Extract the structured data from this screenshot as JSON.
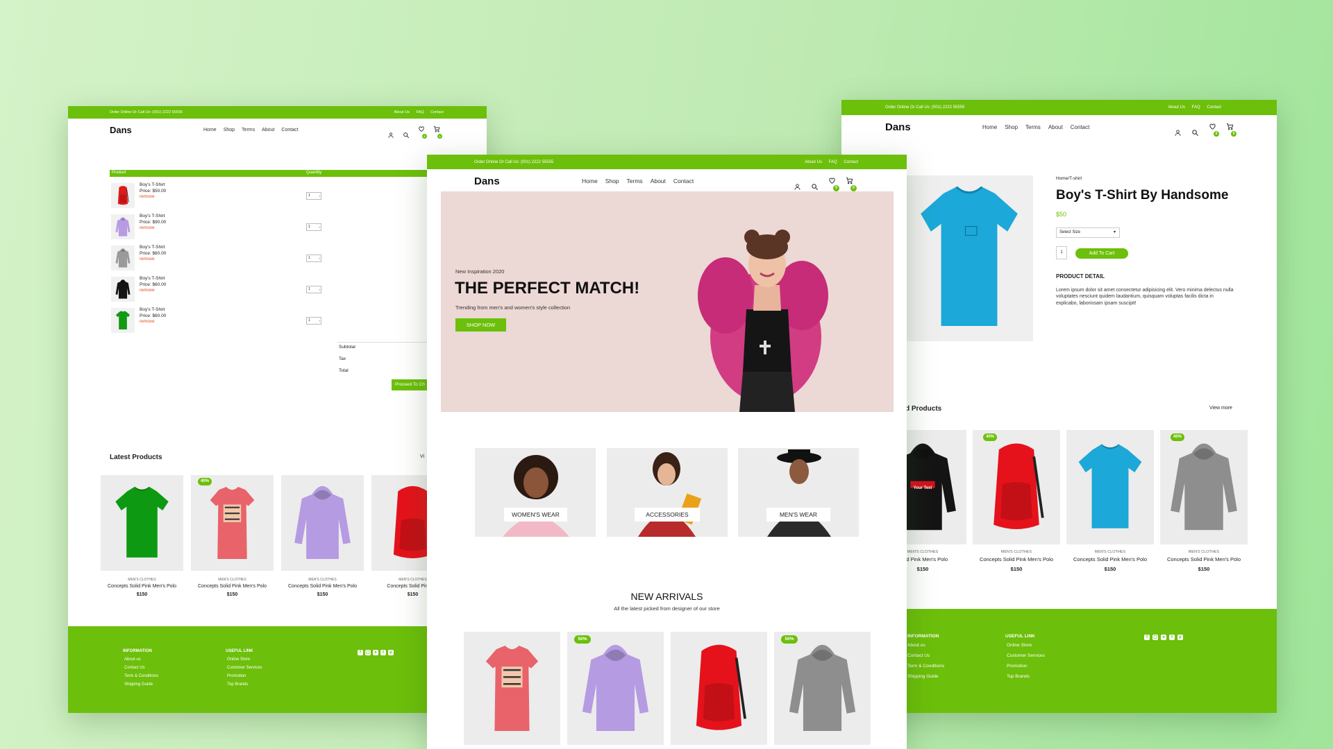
{
  "brand": {
    "name": "Dans",
    "accent": "#6cbf0a"
  },
  "topbar": {
    "phone": "Order Online Or Call Us: (001) 2222 55555",
    "links": [
      "About Us",
      "FAQ",
      "Contact"
    ]
  },
  "nav": [
    "Home",
    "Shop",
    "Terms",
    "About",
    "Contact"
  ],
  "icons": {
    "user": "user-icon",
    "search": "search-icon",
    "wishlist": "heart-icon",
    "cart": "cart-icon",
    "wishlist_count": "0",
    "cart_count": "0"
  },
  "cart_page": {
    "headers": {
      "product": "Product",
      "quantity": "Quantity"
    },
    "items": [
      {
        "name": "Boy's T-Shirt",
        "price": "Price: $50.00",
        "remove": "remove",
        "qty": "1",
        "color": "#e01b1b",
        "kind": "backpack"
      },
      {
        "name": "Boy's T-Shirt",
        "price": "Price: $90.00",
        "remove": "remove",
        "qty": "1",
        "color": "#b89be2",
        "kind": "hoodie"
      },
      {
        "name": "Boy's T-Shirt",
        "price": "Price: $60.00",
        "remove": "remove",
        "qty": "1",
        "color": "#9a9a9a",
        "kind": "hoodie"
      },
      {
        "name": "Boy's T-Shirt",
        "price": "Price: $60.00",
        "remove": "remove",
        "qty": "1",
        "color": "#151515",
        "kind": "hoodie"
      },
      {
        "name": "Boy's T-Shirt",
        "price": "Price: $60.00",
        "remove": "remove",
        "qty": "1",
        "color": "#119a12",
        "kind": "tshirt"
      }
    ],
    "totals": [
      "Subtotal",
      "Tax",
      "Total"
    ],
    "checkout_label": "Proceed To Ch",
    "latest_title": "Latest Products",
    "view_more": "Vi",
    "products": [
      {
        "category": "MEN'S CLOTHES",
        "name": "Concepts Solid Pink Men's Polo",
        "price": "$150",
        "badge": "",
        "color": "#0d9a12",
        "kind": "tshirt"
      },
      {
        "category": "MEN'S CLOTHES",
        "name": "Concepts Solid Pink Men's Polo",
        "price": "$150",
        "badge": "40%",
        "color": "#e8636a",
        "kind": "raw"
      },
      {
        "category": "MEN'S CLOTHES",
        "name": "Concepts Solid Pink Men's Polo",
        "price": "$150",
        "badge": "",
        "color": "#b59be2",
        "kind": "hoodie"
      },
      {
        "category": "MEN'S CLOTHES",
        "name": "Concepts Solid Pink Me",
        "price": "$150",
        "badge": "",
        "color": "#e5121b",
        "kind": "backpack"
      }
    ],
    "footer": {
      "info_title": "INFORMATION",
      "info_links": [
        "About us",
        "Contact Us",
        "Term & Conditions",
        "Shipping Guide"
      ],
      "useful_title": "USEFUL LINK",
      "useful_links": [
        "Online Store",
        "Customer Services",
        "Promotion",
        "Top Brands"
      ]
    }
  },
  "home_page": {
    "hero": {
      "kicker": "New Inspiration 2020",
      "title": "THE PERFECT MATCH!",
      "subtitle": "Trending from men's and women's style collection",
      "cta": "SHOP NOW"
    },
    "categories": [
      {
        "label": "WOMEN'S WEAR"
      },
      {
        "label": "ACCESSORIES"
      },
      {
        "label": "MEN'S WEAR"
      }
    ],
    "arrivals": {
      "title": "NEW ARRIVALS",
      "subtitle": "All the latest picked from designer of our store",
      "items": [
        {
          "badge": "",
          "color": "#e8636a",
          "kind": "raw"
        },
        {
          "badge": "50%",
          "color": "#b59be2",
          "kind": "hoodie"
        },
        {
          "badge": "",
          "color": "#e5121b",
          "kind": "backpack"
        },
        {
          "badge": "50%",
          "color": "#8e8e8e",
          "kind": "hoodie"
        }
      ]
    }
  },
  "product_page": {
    "breadcrumb": "Home/T-shirt",
    "title": "Boy's T-Shirt By Handsome",
    "price": "$50",
    "size_placeholder": "Select Size",
    "qty": "1",
    "add_to_cart": "Add To Cart",
    "detail_title": "PRODUCT DETAIL",
    "detail_text": "Lorem ipsum dolor sit amet consectetur adipisicing elit. Vero minima delectus nulla voluptates nesciunt quidem laudantium, quisquam voluptas facilis dicta in explicabo, laboriosam ipsam suscipit!",
    "related_title": "d Products",
    "view_more": "View more",
    "product_color": "#1ca8d8",
    "related": [
      {
        "category": "MEN'S CLOTHES",
        "name": "Solid Pink Men's Polo",
        "price": "$150",
        "badge": "",
        "color": "#141414",
        "kind": "hoodie",
        "print": "Your Text"
      },
      {
        "category": "MEN'S CLOTHES",
        "name": "Concepts Solid Pink Men's Polo",
        "price": "$150",
        "badge": "40%",
        "color": "#e5121b",
        "kind": "backpack",
        "print": ""
      },
      {
        "category": "MEN'S CLOTHES",
        "name": "Concepts Solid Pink Men's Polo",
        "price": "$150",
        "badge": "",
        "color": "#1ca8d8",
        "kind": "tshirt",
        "print": ""
      },
      {
        "category": "MEN'S CLOTHES",
        "name": "Concepts Solid Pink Men's Polo",
        "price": "$150",
        "badge": "40%",
        "color": "#8e8e8e",
        "kind": "hoodie",
        "print": ""
      }
    ],
    "footer": {
      "info_title": "INFORMATION",
      "info_links": [
        "About us",
        "Contact Us",
        "Term & Conditions",
        "Shipping Guide"
      ],
      "useful_title": "USEFUL LINK",
      "useful_links": [
        "Online Store",
        "Customer Services",
        "Promotion",
        "Top Brands"
      ]
    }
  },
  "social_icons": [
    "facebook-icon",
    "instagram-icon",
    "github-icon",
    "twitter-icon",
    "pinterest-icon"
  ]
}
